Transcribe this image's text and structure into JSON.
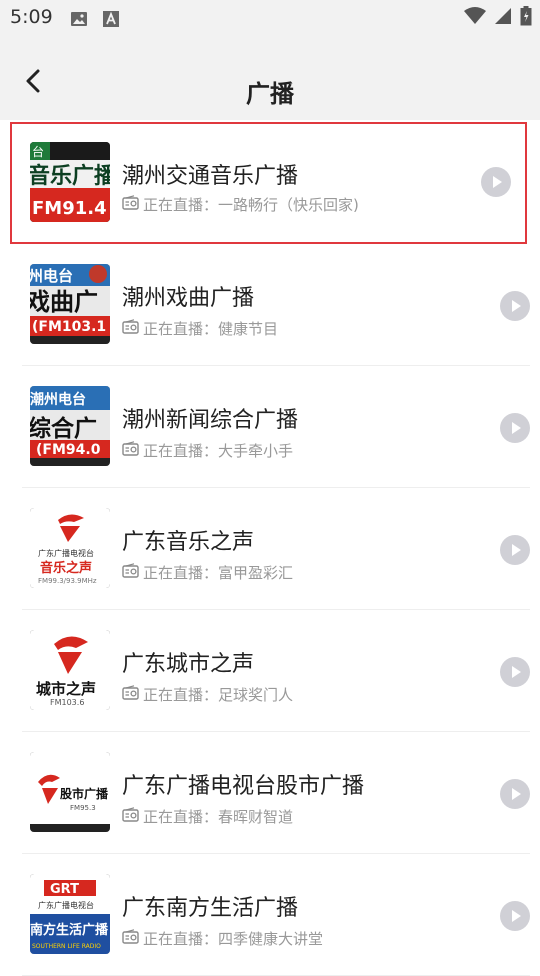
{
  "status_bar": {
    "time": "5:09"
  },
  "header": {
    "title": "广播"
  },
  "stations": [
    {
      "name": "潮州交通音乐广播",
      "now_playing": "正在直播：一路畅行（快乐回家)",
      "logo_text": "音乐广播",
      "logo_freq": "FM91.4",
      "logo_top": "台"
    },
    {
      "name": "潮州戏曲广播",
      "now_playing": "正在直播：健康节目",
      "logo_text": "戏曲广播",
      "logo_freq": "(FM103.1",
      "logo_top": "州电台"
    },
    {
      "name": "潮州新闻综合广播",
      "now_playing": "正在直播：大手牵小手",
      "logo_text": "综合广",
      "logo_freq": "(FM94.0",
      "logo_top": "潮州电台"
    },
    {
      "name": "广东音乐之声",
      "now_playing": "正在直播：富甲盈彩汇",
      "logo_text": "音乐之声",
      "logo_freq": "FM99.3/93.9MHz",
      "logo_top": "广东广播电视台"
    },
    {
      "name": "广东城市之声",
      "now_playing": "正在直播：足球奖门人",
      "logo_text": "城市之声",
      "logo_freq": "FM103.6",
      "logo_top": ""
    },
    {
      "name": "广东广播电视台股市广播",
      "now_playing": "正在直播：春晖财智道",
      "logo_text": "股市广播",
      "logo_freq": "FM95.3",
      "logo_top": ""
    },
    {
      "name": "广东南方生活广播",
      "now_playing": "正在直播：四季健康大讲堂",
      "logo_text": "南方生活广播",
      "logo_freq": "SOUTHERN LIFE RADIO",
      "logo_top": "GRT 广东广播电视台"
    }
  ],
  "colors": {
    "selected_border": "#e0383d",
    "play_button": "#d0d0d6",
    "header_bg": "#f2f2f2"
  }
}
